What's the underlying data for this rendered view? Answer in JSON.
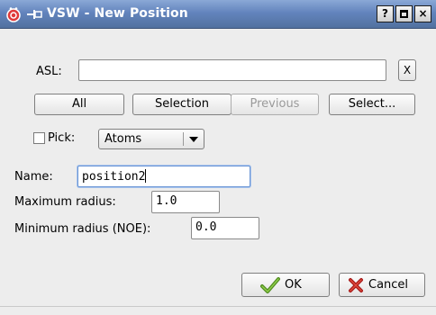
{
  "window": {
    "title": "VSW - New Position",
    "help_label": "?",
    "close_label": "×"
  },
  "asl": {
    "label": "ASL:",
    "value": "",
    "clear_label": "X"
  },
  "selection_buttons": {
    "all": "All",
    "selection": "Selection",
    "previous": "Previous",
    "select": "Select..."
  },
  "pick": {
    "label": "Pick:",
    "checked": false,
    "mode": "Atoms"
  },
  "name": {
    "label": "Name:",
    "value": "position2"
  },
  "max_radius": {
    "label": "Maximum radius:",
    "value": "1.0"
  },
  "min_radius": {
    "label": "Minimum radius (NOE):",
    "value": "0.0"
  },
  "dialog_buttons": {
    "ok": "OK",
    "cancel": "Cancel"
  },
  "colors": {
    "titlebar": "#6384bd",
    "background": "#ededed",
    "focus": "#6b96d6"
  }
}
